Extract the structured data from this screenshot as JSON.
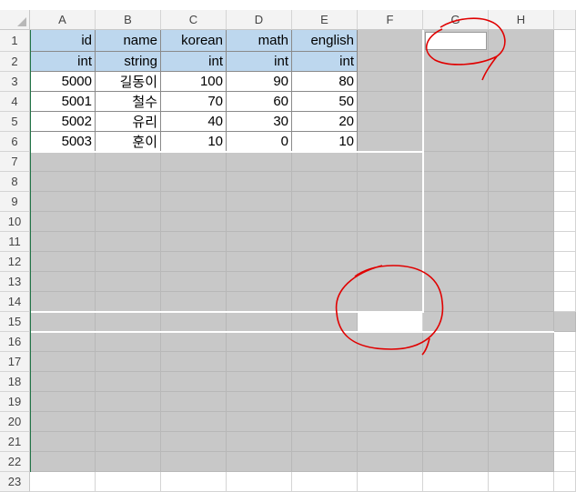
{
  "columns": [
    "A",
    "B",
    "C",
    "D",
    "E",
    "F",
    "G",
    "H"
  ],
  "rows": [
    "1",
    "2",
    "3",
    "4",
    "5",
    "6",
    "7",
    "8",
    "9",
    "10",
    "11",
    "12",
    "13",
    "14",
    "15",
    "16",
    "17",
    "18",
    "19",
    "20",
    "21",
    "22",
    "23"
  ],
  "table": {
    "headers": [
      "id",
      "name",
      "korean",
      "math",
      "english"
    ],
    "types": [
      "int",
      "string",
      "int",
      "int",
      "int"
    ],
    "data": [
      [
        "5000",
        "길동이",
        "100",
        "90",
        "80"
      ],
      [
        "5001",
        "철수",
        "70",
        "60",
        "50"
      ],
      [
        "5002",
        "유리",
        "40",
        "30",
        "20"
      ],
      [
        "5003",
        "훈이",
        "10",
        "0",
        "10"
      ]
    ]
  },
  "colors": {
    "header_fill": "#bdd7ee",
    "masked_fill": "#c8c8c8",
    "annotation": "#e00000",
    "row_col_header": "#f3f3f3"
  },
  "annotations": [
    "red-circle-g1",
    "red-circle-f15"
  ]
}
